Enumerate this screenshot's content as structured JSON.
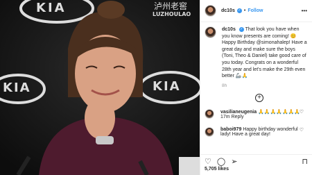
{
  "photo": {
    "logo_top": "KIA",
    "logo_mid": "KIA",
    "logo_right": "KIA",
    "sponsor": "LUZHOULAO",
    "sponsor_cn": "泸州老窖"
  },
  "header": {
    "username": "dc10s",
    "verified_icon": "verified-badge-icon",
    "separator": "•",
    "follow_label": "Follow",
    "more_icon": "more-options-icon"
  },
  "caption": {
    "username": "dc10s",
    "text": "That look you have when you know presents are coming! 😊 Happy Birthday @simonahalep! Have a great day and make sure the boys (Toni, Theo & Daniel) take good care of you today. Congrats on a wonderful 28th year and let's make the 29th even better 🦾🙏",
    "time": "8h"
  },
  "load_more_icon": "plus-circle-icon",
  "comments": [
    {
      "username": "vasilianeugenia",
      "text": "🙏🙏🙏🙏🙏🙏🙏",
      "time": "17m",
      "reply_label": "Reply"
    },
    {
      "username": "baboi979",
      "text": "Happy birthday wonderful lady! Have a great day!",
      "time": "",
      "reply_label": ""
    }
  ],
  "actions": {
    "like_icon": "heart-icon",
    "comment_icon": "comment-icon",
    "share_icon": "share-icon",
    "bookmark_icon": "bookmark-icon",
    "likes_text": "5,705 likes"
  }
}
